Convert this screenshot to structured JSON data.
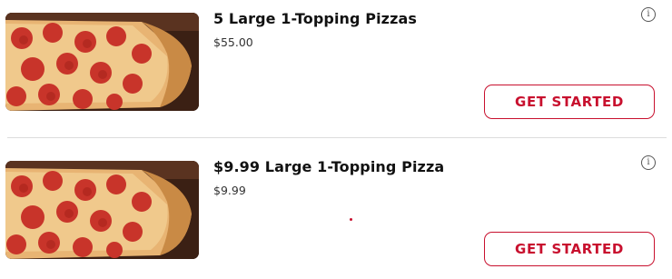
{
  "deals": [
    {
      "title": "5 Large 1-Topping Pizzas",
      "price": "$55.00",
      "cta_label": "GET STARTED",
      "info_icon": "info-icon",
      "image": "pepperoni-pizza-image"
    },
    {
      "title": "$9.99 Large 1-Topping Pizza",
      "price": "$9.99",
      "cta_label": "GET STARTED",
      "info_icon": "info-icon",
      "image": "pepperoni-pizza-image"
    }
  ],
  "colors": {
    "brand_red": "#c8102e",
    "divider": "#dcdcdc",
    "text": "#111111"
  }
}
